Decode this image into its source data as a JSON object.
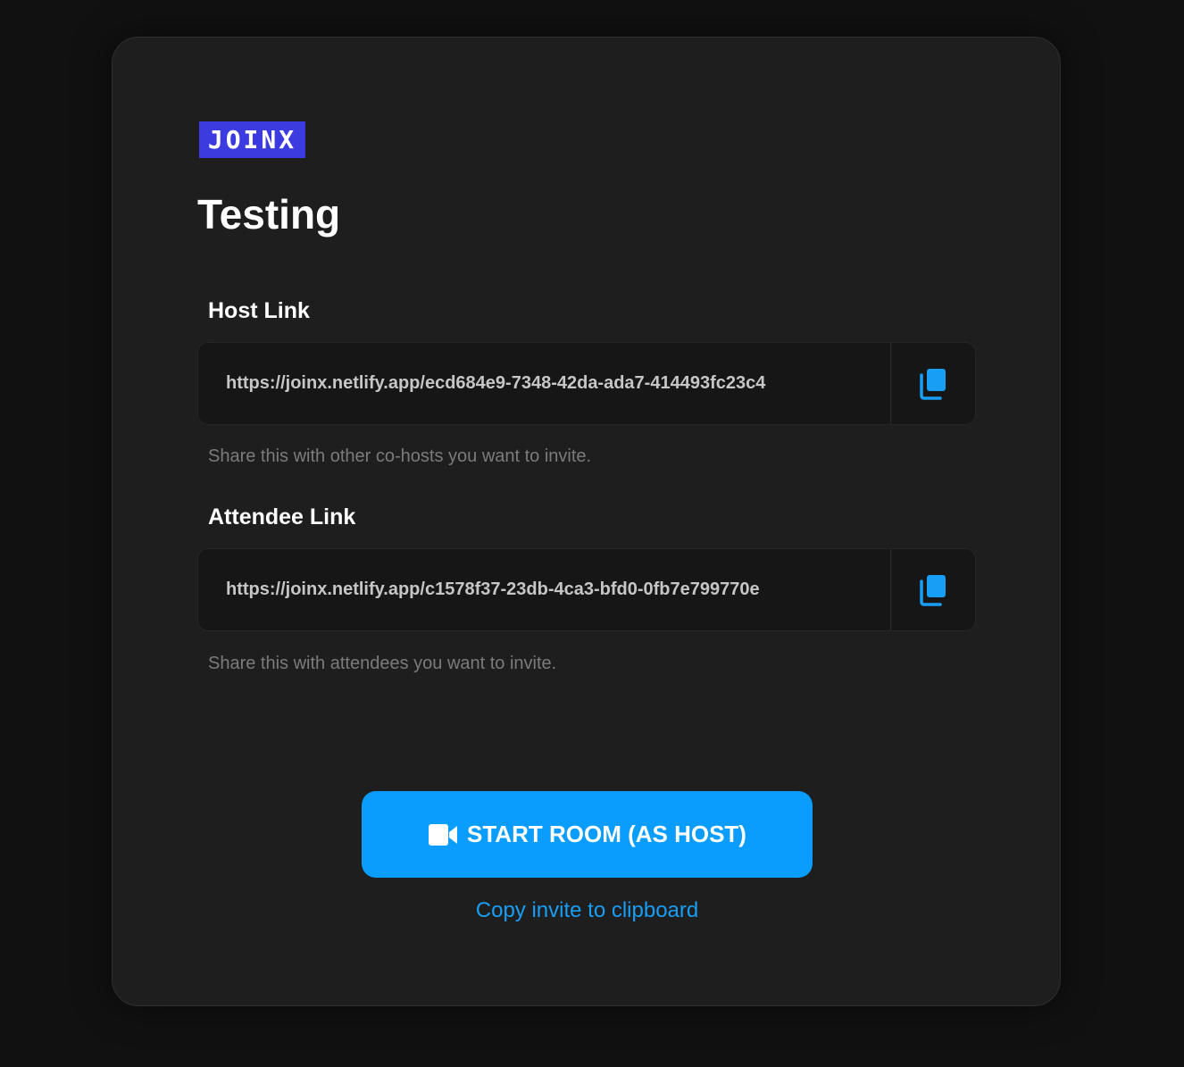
{
  "brand": {
    "logo_text": "JOINX",
    "logo_color": "#3b3be0"
  },
  "room": {
    "title": "Testing"
  },
  "host": {
    "label": "Host Link",
    "url": "https://joinx.netlify.app/ecd684e9-7348-42da-ada7-414493fc23c4",
    "help": "Share this with other co-hosts you want to invite.",
    "copy_icon": "copy-icon"
  },
  "attendee": {
    "label": "Attendee Link",
    "url": "https://joinx.netlify.app/c1578f37-23db-4ca3-bfd0-0fb7e799770e",
    "help": "Share this with attendees you want to invite.",
    "copy_icon": "copy-icon"
  },
  "actions": {
    "start_label": "START ROOM (AS HOST)",
    "start_icon": "video-camera-icon",
    "copy_invite_label": "Copy invite to clipboard"
  },
  "colors": {
    "accent": "#0a9dfd",
    "background": "#111111",
    "card": "#1e1e1e"
  }
}
